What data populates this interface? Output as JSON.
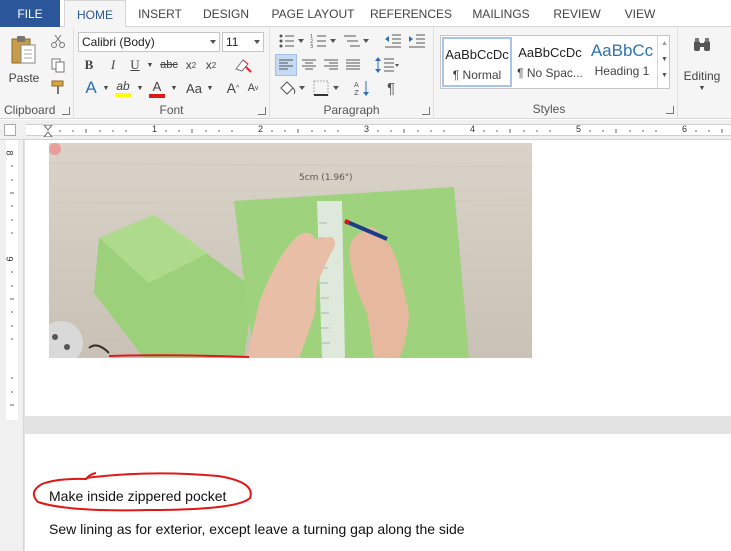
{
  "tabs": [
    "FILE",
    "HOME",
    "INSERT",
    "DESIGN",
    "PAGE LAYOUT",
    "REFERENCES",
    "MAILINGS",
    "REVIEW",
    "VIEW"
  ],
  "clipboard": {
    "paste_label": "Paste",
    "group_label": "Clipboard"
  },
  "font": {
    "name": "Calibri (Body)",
    "size": "11",
    "group_label": "Font"
  },
  "paragraph": {
    "group_label": "Paragraph"
  },
  "styles": {
    "group_label": "Styles",
    "items": [
      {
        "sample": "AaBbCcDc",
        "name": "¶ Normal"
      },
      {
        "sample": "AaBbCcDc",
        "name": "¶ No Spac..."
      },
      {
        "sample": "AaBbCc",
        "name": "Heading 1"
      }
    ]
  },
  "editing": {
    "label": "Editing"
  },
  "ruler": {
    "numbers": [
      "1",
      "2",
      "3",
      "4",
      "5",
      "6"
    ],
    "vnumbers": [
      "8",
      "9"
    ]
  },
  "photo": {
    "caption": "5cm  (1.96\")"
  },
  "document": {
    "heading": "Make inside zippered pocket",
    "paragraph": "Sew lining as for exterior, except leave a turning gap along the side"
  },
  "colors": {
    "accent": "#2b579a",
    "annotation": "#e01818"
  }
}
